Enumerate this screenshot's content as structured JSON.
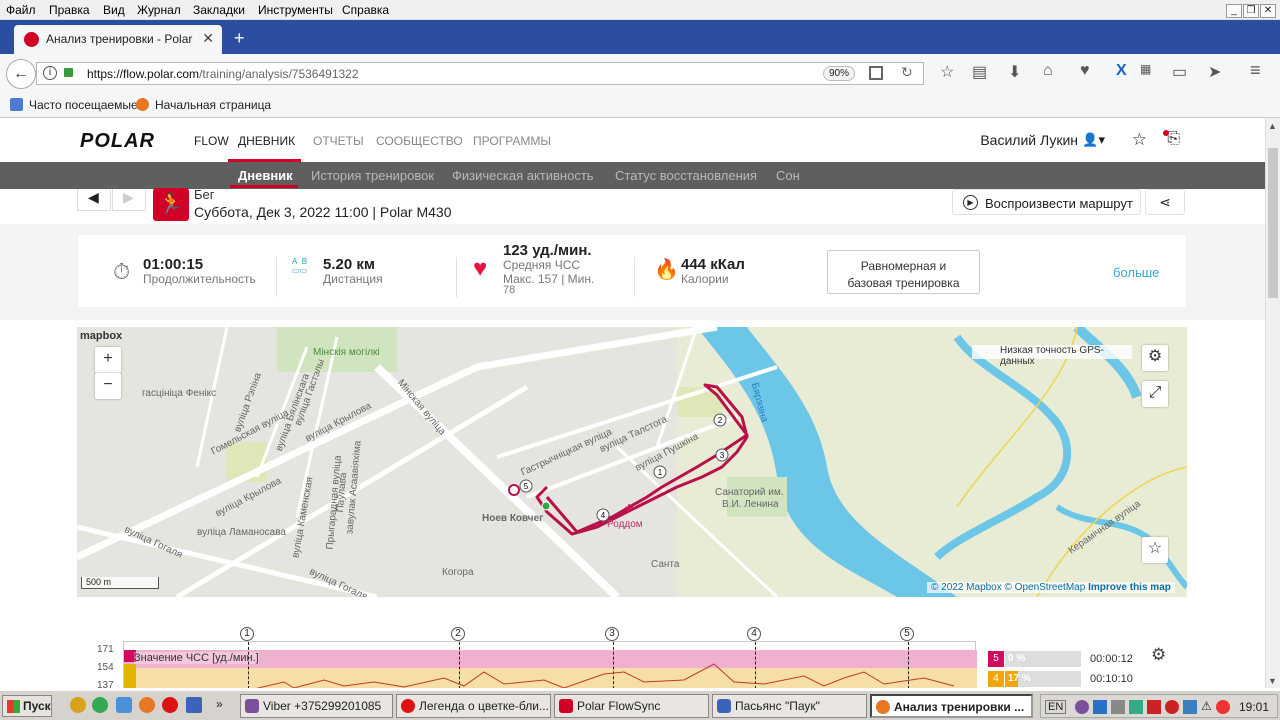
{
  "browser": {
    "menu": [
      "Файл",
      "Правка",
      "Вид",
      "Журнал",
      "Закладки",
      "Инструменты",
      "Справка"
    ],
    "tab_title": "Анализ тренировки - Polar F...",
    "url_host": "https://flow.polar.com",
    "url_path": "/training/analysis/7536491322",
    "zoom": "90%",
    "bookmarks": [
      "Часто посещаемые",
      "Начальная страница"
    ]
  },
  "site": {
    "logo": "POLAR",
    "nav": [
      "FLOW",
      "ДНЕВНИК",
      "ОТЧЕТЫ",
      "СООБЩЕСТВО",
      "ПРОГРАММЫ"
    ],
    "user": "Василий Лукин",
    "subnav": [
      "Дневник",
      "История тренировок",
      "Физическая активность",
      "Статус восстановления",
      "Сон"
    ]
  },
  "session": {
    "sport": "Бег",
    "datetime_device": "Суббота, Дек 3, 2022 11:00 | Polar M430",
    "replay_label": "Воспроизвести маршрут"
  },
  "summary": {
    "duration": "01:00:15",
    "duration_label": "Продолжительность",
    "distance": "5.20 км",
    "distance_label": "Дистанция",
    "hr_avg": "123 уд./мин.",
    "hr_label": "Средняя ЧСС",
    "hr_maxmin_a": "Макс. 157  |  Мин.",
    "hr_maxmin_b": "78",
    "calories": "444 кКал",
    "calories_label": "Калории",
    "type_line1": "Равномерная и",
    "type_line2": "базовая тренировка",
    "more": "больше"
  },
  "map": {
    "attribution_logo": "mapbox",
    "legend": "Низкая точность GPS-данных",
    "scale": "500 m",
    "copyright": "© 2022 Mapbox",
    "osm": "© OpenStreetMap",
    "improve": "Improve this map",
    "labels": {
      "minsk_cem": "Мінскія могілкі",
      "hotel": "гасцініца Фенікс",
      "rechitsa": "вуліца Рэпіна",
      "gastelo": "вуліца Гастэлы",
      "belinsk": "вуліца Бялінскага",
      "gomel": "Гомельская вуліца",
      "krylova": "вуліца Крылова",
      "krylova2": "вуліца Крылова",
      "minsk_st": "Мінская вуліца",
      "kam": "вуліца Каменская",
      "lam": "вуліца Ламаносава",
      "prig": "Прыгарадная вуліца",
      "payl": "Паўлава",
      "asav": "завулак Асаавіяхіма",
      "gogal": "вуліца Гогаля",
      "gogal2": "вуліца Гогаля",
      "tolst": "вуліца Талстога",
      "push": "вуліца Пушкіна",
      "tract": "Гастрычніцкая вуліца",
      "noah": "Ноев Ковчег",
      "roddom": "Роддом",
      "sanat1": "Санаторий им.",
      "sanat2": "В.И. Ленина",
      "santa": "Санта",
      "kogora": "Когора",
      "river": "Бярэзіна",
      "keram": "Керамічная вуліца"
    }
  },
  "chart": {
    "y_ticks": [
      "171",
      "154",
      "137"
    ],
    "series_label": "Значение ЧСС [уд./мин.]",
    "laps": [
      "1",
      "2",
      "3",
      "4",
      "5"
    ],
    "zones": [
      {
        "zone": "5",
        "pct": "0 %",
        "time": "00:00:12",
        "color": "#d10c5e"
      },
      {
        "zone": "4",
        "pct": "17 %",
        "time": "00:10:10",
        "color": "#f2a60b"
      }
    ]
  },
  "taskbar": {
    "start": "Пуск",
    "tasks": [
      "Viber +375299201085",
      "Легенда о цветке-бли...",
      "Polar FlowSync",
      "Пасьянс \"Паук\"",
      "Анализ тренировки ..."
    ],
    "lang": "EN",
    "clock": "19:01"
  }
}
